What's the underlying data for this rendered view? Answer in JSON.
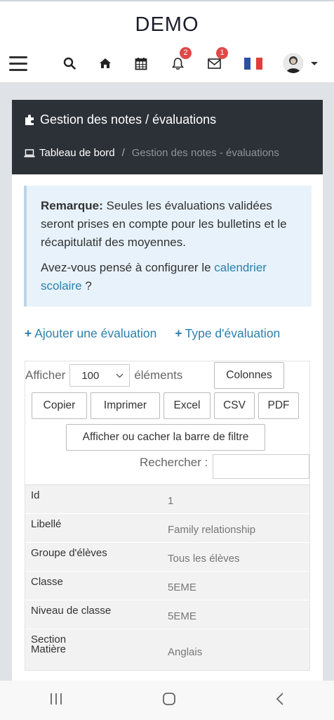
{
  "app": {
    "title": "DEMO"
  },
  "nav": {
    "notifications_count": "2",
    "messages_count": "1",
    "colors": {
      "flag_blue": "#2f4fa5",
      "flag_white": "#ffffff",
      "flag_red": "#e33b3b",
      "badge": "#e04848"
    }
  },
  "card": {
    "title": "Gestion des notes / évaluations",
    "breadcrumb": {
      "home": "Tableau de bord",
      "separator": "/",
      "current": "Gestion des notes - évaluations"
    }
  },
  "note": {
    "strong": "Remarque:",
    "text": " Seules les évaluations validées seront prises en compte pour les bulletins et le récapitulatif des moyennes.",
    "question_prefix": "Avez-vous pensé à configurer le ",
    "link": "calendrier scolaire",
    "question_suffix": " ?"
  },
  "actions": {
    "add": "Ajouter une évaluation",
    "type": "Type d'évaluation"
  },
  "datatable": {
    "show_label": "Afficher",
    "length_value": "100",
    "elements_label": "éléments",
    "columns_btn": "Colonnes",
    "buttons": [
      "Copier",
      "Imprimer",
      "Excel",
      "CSV",
      "PDF"
    ],
    "filter_btn": "Afficher ou cacher la barre de filtre",
    "search_label": "Rechercher :",
    "rows": [
      {
        "label": "Id",
        "value": "1"
      },
      {
        "label": "Libellé",
        "value": "Family relationship"
      },
      {
        "label": "Groupe d'élèves",
        "value": "Tous les élèves"
      },
      {
        "label": "Classe",
        "value": "5EME"
      },
      {
        "label": "Niveau de classe",
        "value": "5EME"
      },
      {
        "label": "Section",
        "value": ""
      },
      {
        "label": "Matière",
        "value": "Anglais"
      }
    ]
  }
}
